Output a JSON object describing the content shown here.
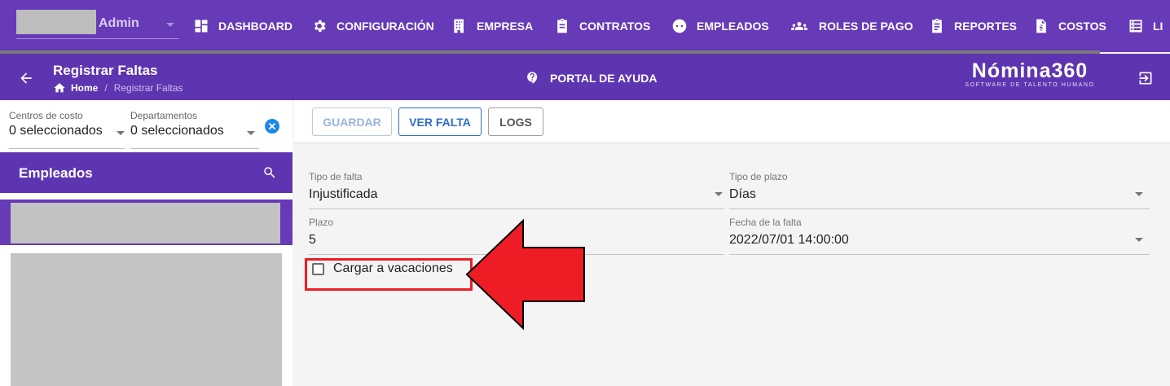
{
  "user": {
    "name": "Admin"
  },
  "nav": {
    "items": [
      {
        "label": "DASHBOARD",
        "icon": "dashboard-icon"
      },
      {
        "label": "CONFIGURACIÓN",
        "icon": "gear-icon"
      },
      {
        "label": "EMPRESA",
        "icon": "building-icon"
      },
      {
        "label": "CONTRATOS",
        "icon": "clipboard-icon"
      },
      {
        "label": "EMPLEADOS",
        "icon": "face-icon"
      },
      {
        "label": "ROLES DE PAGO",
        "icon": "people-icon"
      },
      {
        "label": "REPORTES",
        "icon": "clipboard-list-icon"
      },
      {
        "label": "COSTOS",
        "icon": "cost-file-icon"
      },
      {
        "label": "LI",
        "icon": "list-icon"
      }
    ]
  },
  "header": {
    "title": "Registrar Faltas",
    "breadcrumb": {
      "home": "Home",
      "separator": "/",
      "current": "Registrar Faltas"
    },
    "help_label": "PORTAL DE AYUDA",
    "brand": {
      "name": "Nómina360",
      "tagline": "SOFTWARE DE TALENTO HUMANO"
    }
  },
  "filters": {
    "cost_centers": {
      "label": "Centros de costo",
      "value": "0 seleccionados"
    },
    "departments": {
      "label": "Departamentos",
      "value": "0 seleccionados"
    }
  },
  "employees": {
    "title": "Empleados"
  },
  "toolbar": {
    "save_label": "GUARDAR",
    "view_label": "VER FALTA",
    "logs_label": "LOGS"
  },
  "form": {
    "absence_type": {
      "label": "Tipo de falta",
      "value": "Injustificada"
    },
    "term_type": {
      "label": "Tipo de plazo",
      "value": "Días"
    },
    "term": {
      "label": "Plazo",
      "value": "5"
    },
    "absence_date": {
      "label": "Fecha de la falta",
      "value": "2022/07/01 14:00:00"
    },
    "charge_to_vacation": {
      "label": "Cargar a vacaciones",
      "checked": false
    }
  },
  "colors": {
    "primary": "#673ab7",
    "subheader": "#5e35b1",
    "accent_blue": "#2f6ec7",
    "annotation_red": "#ee1c24"
  }
}
